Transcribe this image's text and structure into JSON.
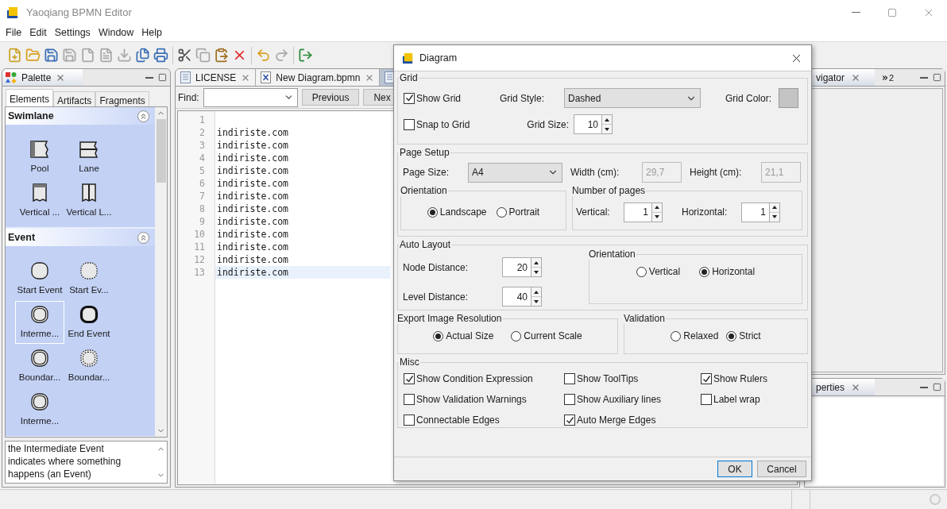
{
  "window": {
    "title": "Yaoqiang BPMN Editor"
  },
  "menu": [
    "File",
    "Edit",
    "Settings",
    "Window",
    "Help"
  ],
  "toolbar": [
    {
      "kind": "new",
      "disabled": false
    },
    {
      "kind": "open",
      "disabled": false
    },
    {
      "kind": "save",
      "disabled": false
    },
    {
      "kind": "save-as",
      "disabled": true
    },
    {
      "kind": "document",
      "disabled": true
    },
    {
      "kind": "template",
      "disabled": true
    },
    {
      "kind": "export",
      "disabled": true
    },
    {
      "kind": "save-all",
      "disabled": false
    },
    {
      "kind": "print",
      "disabled": false
    },
    {
      "kind": "separator"
    },
    {
      "kind": "cut",
      "disabled": false
    },
    {
      "kind": "copy",
      "disabled": true
    },
    {
      "kind": "paste",
      "disabled": false
    },
    {
      "kind": "delete",
      "disabled": false
    },
    {
      "kind": "separator"
    },
    {
      "kind": "undo",
      "disabled": false
    },
    {
      "kind": "redo",
      "disabled": true
    },
    {
      "kind": "separator"
    },
    {
      "kind": "exit",
      "disabled": false
    }
  ],
  "palette": {
    "title": "Palette",
    "tabs": [
      {
        "label": "Elements",
        "selected": true
      },
      {
        "label": "Artifacts",
        "selected": false
      },
      {
        "label": "Fragments",
        "selected": false
      }
    ],
    "sections": [
      {
        "title": "Swimlane",
        "expanded": true,
        "items": [
          {
            "kind": "pool",
            "label": "Pool",
            "selected": false
          },
          {
            "kind": "lane",
            "label": "Lane",
            "selected": false
          },
          {
            "kind": "vertical-pool",
            "label": "Vertical ...",
            "selected": false
          },
          {
            "kind": "vertical-lane",
            "label": "Vertical L...",
            "selected": false
          }
        ]
      },
      {
        "title": "Event",
        "expanded": true,
        "items": [
          {
            "kind": "start",
            "label": "Start Event",
            "selected": false
          },
          {
            "kind": "start-dotted",
            "label": "Start Ev...",
            "selected": false
          },
          {
            "kind": "intermediate",
            "label": "Interme...",
            "selected": true
          },
          {
            "kind": "end",
            "label": "End Event",
            "selected": false
          },
          {
            "kind": "intermediate",
            "label": "Boundar...",
            "selected": false
          },
          {
            "kind": "boundary-dotted",
            "label": "Boundar...",
            "selected": false
          },
          {
            "kind": "intermediate",
            "label": "Interme...",
            "selected": false
          }
        ]
      }
    ],
    "description": "the Intermediate Event indicates where something happens (an Event)"
  },
  "editor": {
    "tabs": [
      {
        "kind": "text",
        "label": "LICENSE",
        "selected": false
      },
      {
        "kind": "bpmn",
        "label": "New Diagram.bpmn",
        "selected": false
      },
      {
        "kind": "text",
        "selected": true
      }
    ],
    "find": {
      "label": "Find:",
      "buttons": [
        "Previous",
        "Nex"
      ]
    },
    "lines": [
      {
        "number": "1",
        "current": false
      },
      {
        "number": "2",
        "text": "indiriste.com",
        "current": false
      },
      {
        "number": "3",
        "text": "indiriste.com",
        "current": false
      },
      {
        "number": "4",
        "text": "indiriste.com",
        "current": false
      },
      {
        "number": "5",
        "text": "indiriste.com",
        "current": false
      },
      {
        "number": "6",
        "text": "indiriste.com",
        "current": false
      },
      {
        "number": "7",
        "text": "indiriste.com",
        "current": false
      },
      {
        "number": "8",
        "text": "indiriste.com",
        "current": false
      },
      {
        "number": "9",
        "text": "indiriste.com",
        "current": false
      },
      {
        "number": "10",
        "text": "indiriste.com",
        "current": false
      },
      {
        "number": "11",
        "text": "indiriste.com",
        "current": false
      },
      {
        "number": "12",
        "text": "indiriste.com",
        "current": false
      },
      {
        "number": "13",
        "text": "indiriste.com",
        "current": true
      }
    ]
  },
  "navigator": {
    "tab": "vigator",
    "overflow_count": "2"
  },
  "properties": {
    "tab": "perties"
  },
  "dialog": {
    "title": "Diagram",
    "grid": {
      "title": "Grid",
      "show_grid": {
        "label": "Show Grid",
        "checked": true
      },
      "snap_to_grid": {
        "label": "Snap to Grid",
        "checked": false
      },
      "style_label": "Grid Style:",
      "style": "Dashed",
      "size_label": "Grid Size:",
      "size": "10",
      "color_label": "Grid Color:",
      "color": "#c4c4c4"
    },
    "page_setup": {
      "title": "Page Setup",
      "size_label": "Page Size:",
      "size": "A4",
      "width": {
        "label": "Width (cm):",
        "value": "29,7",
        "disabled": true
      },
      "height": {
        "label": "Height (cm):",
        "value": "21,1",
        "disabled": true
      },
      "orientation": {
        "title": "Orientation",
        "options": [
          {
            "label": "Landscape",
            "selected": true
          },
          {
            "label": "Portrait",
            "selected": false
          }
        ]
      },
      "pages": {
        "title": "Number of pages",
        "vertical_label": "Vertical:",
        "vertical": "1",
        "horizontal_label": "Horizontal:",
        "horizontal": "1"
      }
    },
    "auto_layout": {
      "title": "Auto Layout",
      "fields": [
        {
          "label": "Node Distance:",
          "value": "20"
        },
        {
          "label": "Level Distance:",
          "value": "40"
        }
      ],
      "orientation": {
        "title": "Orientation",
        "options": [
          {
            "label": "Vertical",
            "selected": false
          },
          {
            "label": "Horizontal",
            "selected": true
          }
        ]
      }
    },
    "export": {
      "title": "Export Image Resolution",
      "options": [
        {
          "label": "Actual Size",
          "selected": true
        },
        {
          "label": "Current Scale",
          "selected": false
        }
      ]
    },
    "validation": {
      "title": "Validation",
      "options": [
        {
          "label": "Relaxed",
          "selected": false
        },
        {
          "label": "Strict",
          "selected": true
        }
      ]
    },
    "misc": {
      "title": "Misc",
      "options": [
        {
          "label": "Show Condition Expression",
          "checked": true
        },
        {
          "label": "Show ToolTips",
          "checked": false
        },
        {
          "label": "Show Rulers",
          "checked": true
        },
        {
          "label": "Show Validation Warnings",
          "checked": false
        },
        {
          "label": "Show Auxiliary lines",
          "checked": false
        },
        {
          "label": "Label wrap",
          "checked": false
        },
        {
          "label": "Connectable Edges",
          "checked": false
        },
        {
          "label": "Auto Merge Edges",
          "checked": true
        }
      ]
    },
    "buttons": [
      {
        "label": "OK",
        "default": true
      },
      {
        "label": "Cancel",
        "default": false
      }
    ]
  }
}
